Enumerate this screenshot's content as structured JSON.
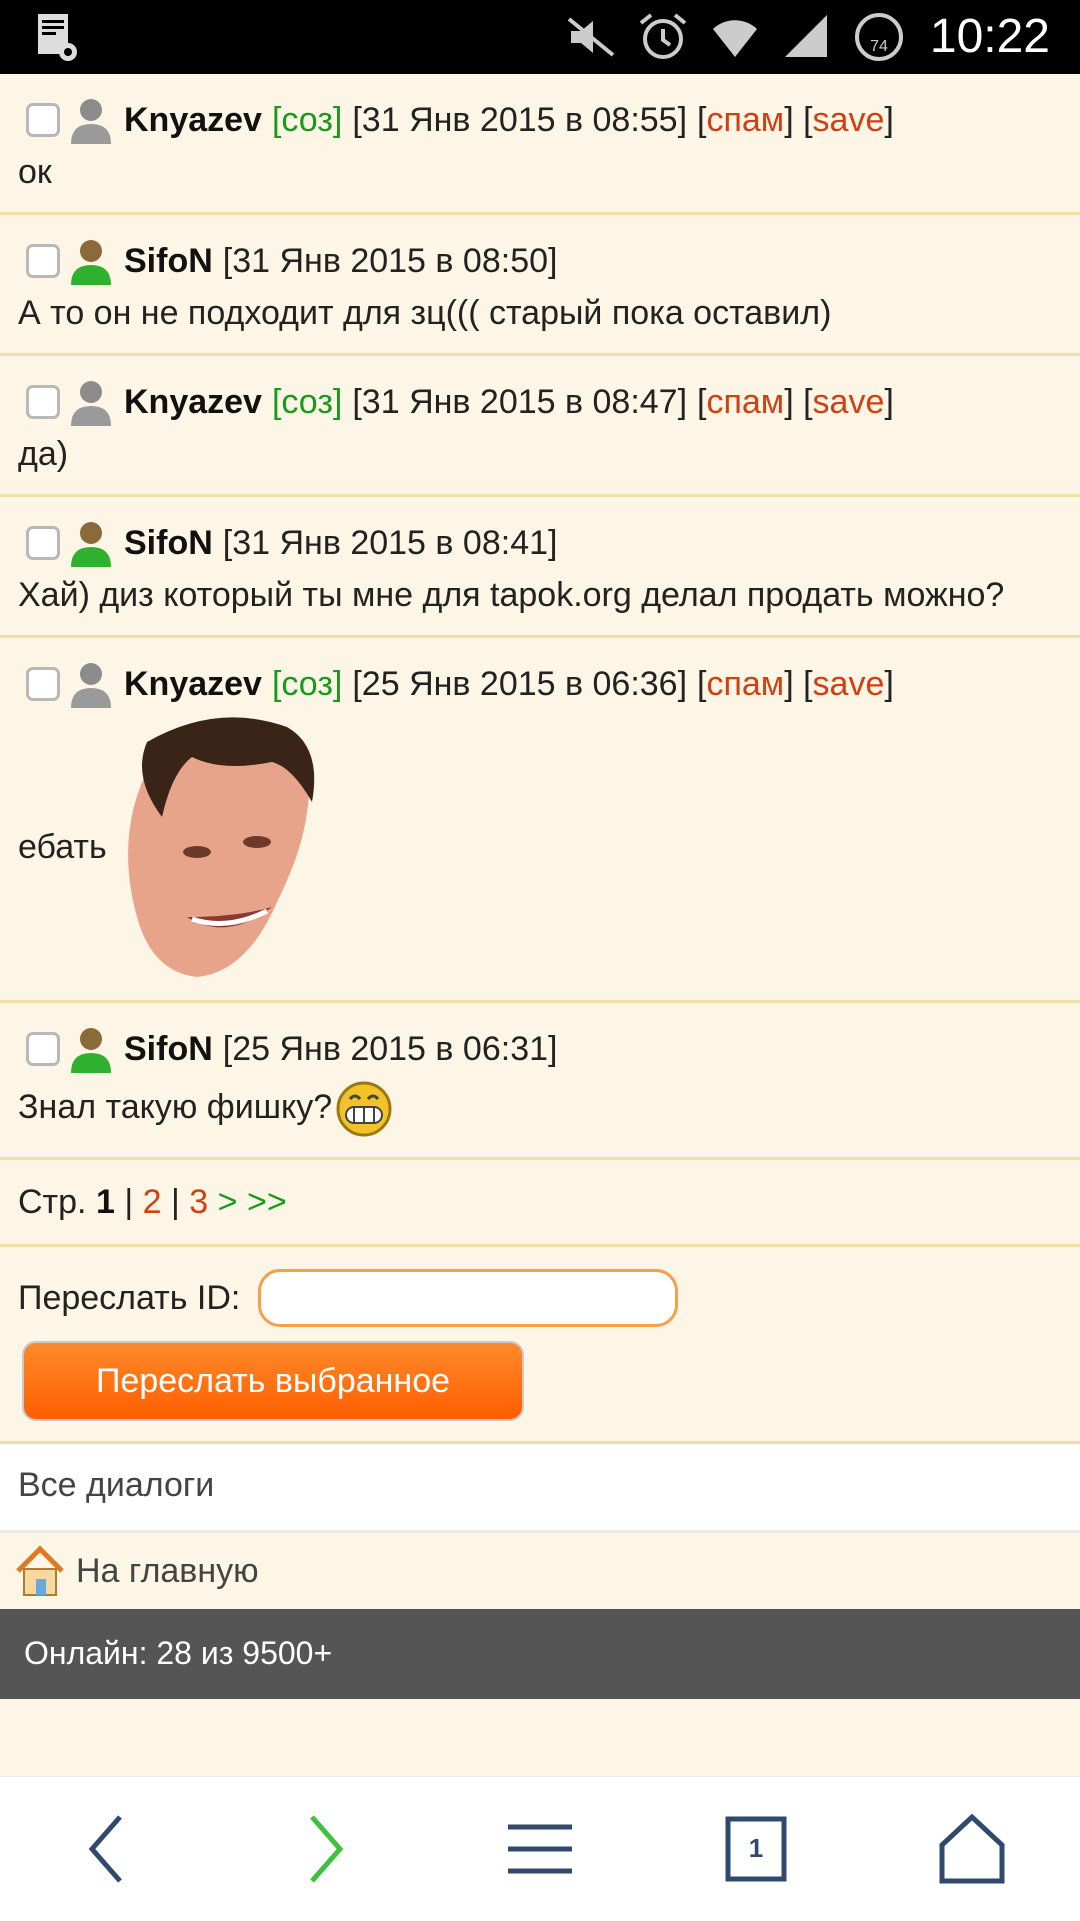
{
  "status_bar": {
    "time": "10:22",
    "battery_level": "74"
  },
  "messages": [
    {
      "author": "Knyazev",
      "coz": "[соз]",
      "date": "[31 Янв 2015 в 08:55]",
      "spam": "спам",
      "save": "save",
      "text": "ок"
    },
    {
      "author": "SifoN",
      "date": "[31 Янв 2015 в 08:50]",
      "text": "А то он не подходит для зц((( старый пока оставил)"
    },
    {
      "author": "Knyazev",
      "coz": "[соз]",
      "date": "[31 Янв 2015 в 08:47]",
      "spam": "спам",
      "save": "save",
      "text": "да)"
    },
    {
      "author": "SifoN",
      "date": "[31 Янв 2015 в 08:41]",
      "text": "Хай) диз который ты мне для tapok.org делал продать можно?"
    },
    {
      "author": "Knyazev",
      "coz": "[соз]",
      "date": "[25 Янв 2015 в 06:36]",
      "spam": "спам",
      "save": "save",
      "text": "ебать"
    },
    {
      "author": "SifoN",
      "date": "[25 Янв 2015 в 06:31]",
      "text": "Знал такую фишку?"
    }
  ],
  "pager": {
    "prefix": "Стр.",
    "current": "1",
    "sep": "|",
    "page2": "2",
    "page3": "3",
    "next": ">",
    "last": ">>"
  },
  "forward": {
    "label": "Переслать ID:",
    "input_value": "",
    "button_label": "Переслать выбранное"
  },
  "links": {
    "all_dialogs": "Все диалоги",
    "home": "На главную"
  },
  "footer": {
    "online": "Онлайн: 28 из 9500+"
  },
  "browser_nav": {
    "tabs_count": "1"
  }
}
